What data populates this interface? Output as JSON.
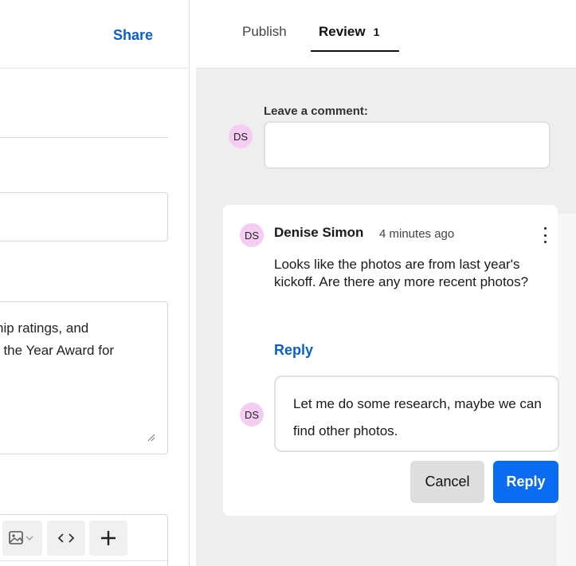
{
  "editor": {
    "share_label": "Share",
    "textarea_text": "hip ratings, and\nf the Year Award for",
    "toolbar": {
      "image_icon": "image-dropdown-icon",
      "code_icon": "code-icon",
      "plus_icon": "plus-icon"
    }
  },
  "review_panel": {
    "tabs": {
      "publish": "Publish",
      "review": "Review",
      "review_count": "1"
    },
    "leave_comment_label": "Leave a comment:",
    "current_user_initials": "DS",
    "comment": {
      "initials": "DS",
      "author": "Denise Simon",
      "time": "4 minutes ago",
      "body": "Looks like the photos are from last year's kickoff. Are there any more recent photos?",
      "reply_link": "Reply"
    },
    "reply_draft": {
      "initials": "DS",
      "text": "Let me do some research, maybe we can find other photos."
    },
    "buttons": {
      "cancel": "Cancel",
      "reply": "Reply"
    }
  },
  "colors": {
    "accent_blue": "#0a6cf0",
    "avatar_pink": "#f6cdf2",
    "panel_gray": "#eeeeee"
  }
}
